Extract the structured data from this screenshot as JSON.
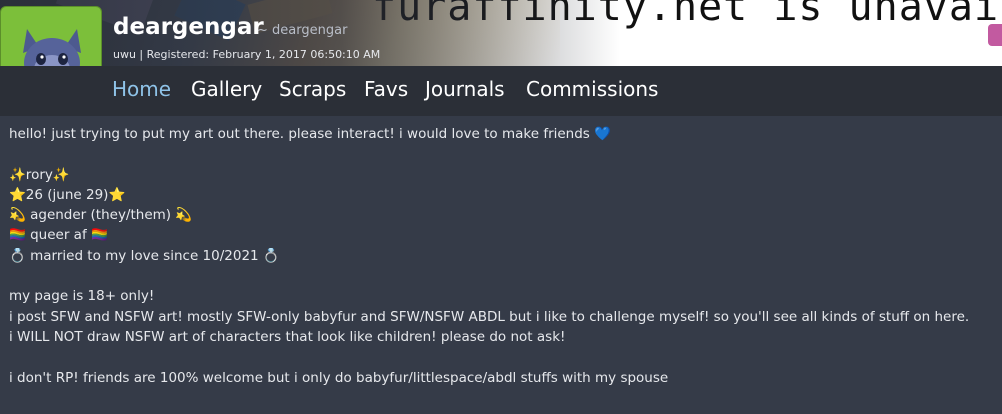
{
  "banner": {
    "text": "furaffinity.net is unavailable"
  },
  "profile": {
    "username": "deargengar",
    "handle": "~ deargengar",
    "title_line": "uwu | Registered: February 1, 2017 06:50:10 AM"
  },
  "nav": {
    "items": [
      "Home",
      "Gallery",
      "Scraps",
      "Favs",
      "Journals",
      "Commissions"
    ],
    "active": "Home"
  },
  "bio": {
    "line1": "hello! just trying to put my art out there. please interact! i would love to make friends 💙",
    "line2": "✨rory✨",
    "line3": "⭐26 (june 29)⭐",
    "line4": "💫 agender (they/them) 💫",
    "line5": "🏳️‍🌈 queer af 🏳️‍🌈",
    "line6": "💍 married to my love since 10/2021 💍",
    "line7": "my page is 18+ only!",
    "line8": "i post SFW and NSFW art! mostly SFW-only babyfur and SFW/NSFW ABDL but i like to challenge myself! so you'll see all kinds of stuff on here.",
    "line9": "i WILL NOT draw NSFW art of characters that look like children! please do not ask!",
    "line10": "i don't RP! friends are 100% welcome but i only do babyfur/littlespace/abdl stuffs with my spouse"
  },
  "colors": {
    "accent_nav_active": "#8fc3e8",
    "avatar_bg": "#7cbf3a",
    "page_bg": "#353b48"
  }
}
